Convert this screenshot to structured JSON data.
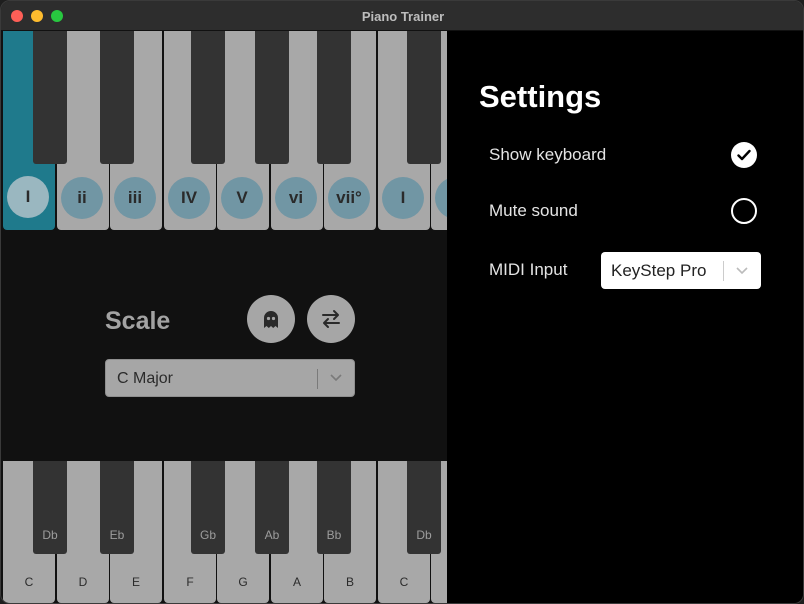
{
  "window": {
    "title": "Piano Trainer"
  },
  "chord_keyboard": {
    "chords": [
      "I",
      "ii",
      "iii",
      "IV",
      "V",
      "vi",
      "vii°",
      "I"
    ],
    "active_index": 0
  },
  "scale_panel": {
    "label": "Scale",
    "ghost_button_icon": "ghost-icon",
    "swap_button_icon": "swap-arrows-icon",
    "select_value": "C Major"
  },
  "note_keyboard": {
    "white_labels": [
      "C",
      "D",
      "E",
      "F",
      "G",
      "A",
      "B",
      "C"
    ],
    "black_labels": [
      "Db",
      "Eb",
      "Gb",
      "Ab",
      "Bb",
      "Db"
    ]
  },
  "settings": {
    "title": "Settings",
    "show_keyboard": {
      "label": "Show keyboard",
      "checked": true
    },
    "mute_sound": {
      "label": "Mute sound",
      "checked": false
    },
    "midi_input": {
      "label": "MIDI Input",
      "value": "KeyStep Pro"
    }
  },
  "colors": {
    "active_key": "#1f7a8c",
    "chord_badge": "#7196a4",
    "white_key": "#a8a8a8",
    "black_key": "#333333"
  }
}
